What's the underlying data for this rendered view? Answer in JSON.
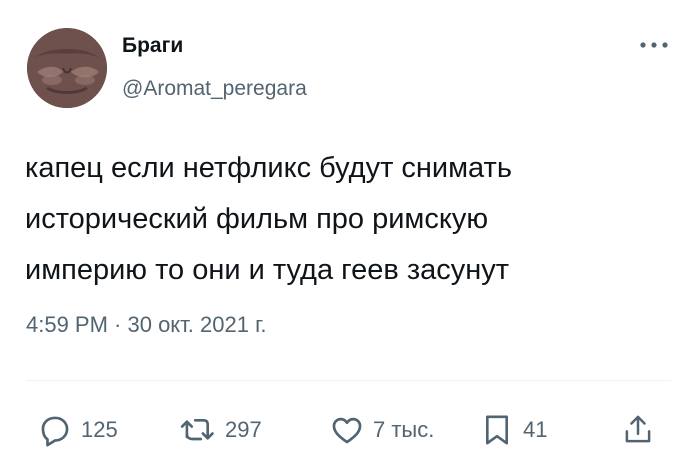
{
  "tweet": {
    "author": {
      "display_name": "Браги",
      "handle": "@Aromat_peregara",
      "avatar_icon": "face-closeup-avatar"
    },
    "text": "капец если нетфликс будут снимать\nисторический фильм про римскую\nимперию то они и туда геев засунут",
    "timestamp": "4:59 PM · 30 окт. 2021 г."
  },
  "actions": {
    "replies": "125",
    "retweets": "297",
    "likes": "7 тыс.",
    "bookmarks": "41"
  },
  "colors": {
    "text": "#0f1419",
    "secondary": "#536471",
    "divider": "#eff3f4"
  }
}
